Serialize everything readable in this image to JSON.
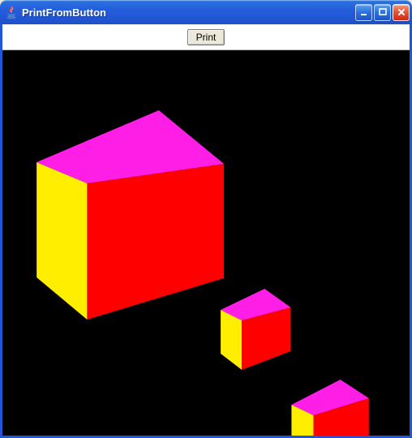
{
  "window": {
    "title": "PrintFromButton",
    "icon_name": "java-icon",
    "minimize_tip": "Minimize",
    "maximize_tip": "Maximize",
    "close_tip": "Close"
  },
  "toolbar": {
    "print_label": "Print"
  },
  "scene": {
    "description": "3D viewport with black background and three cubes",
    "cube_face_colors": {
      "top": "#ff1ee6",
      "front": "#ff0000",
      "left": "#ffee00"
    }
  }
}
